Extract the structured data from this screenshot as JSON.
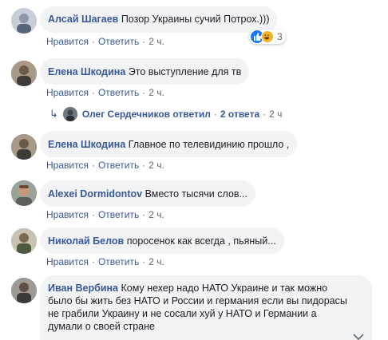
{
  "comments": [
    {
      "author": "Алсай Шагаев",
      "text": "Позор Украины сучий Потрох.)))",
      "like_label": "Нравится",
      "reply_label": "Ответить",
      "time": "2 ч.",
      "reactions": {
        "count": "3",
        "icons": [
          "like-icon",
          "haha-icon"
        ]
      }
    },
    {
      "author": "Елена Шкодина",
      "text": "Это выступление для тв",
      "like_label": "Нравится",
      "reply_label": "Ответить",
      "time": "2 ч.",
      "replies": {
        "text": "Олег Сердечников ответил",
        "count": "2 ответа",
        "time": "2 ч"
      }
    },
    {
      "author": "Елена Шкодина",
      "text": "Главное по телевидинию прошло ,",
      "like_label": "Нравится",
      "reply_label": "Ответить",
      "time": "2 ч."
    },
    {
      "author": "Alexei Dormidontov",
      "text": "Вместо тысячи слов...",
      "like_label": "Нравится",
      "reply_label": "Ответить",
      "time": "2 ч."
    },
    {
      "author": "Николай Белов",
      "text": "поросенок как всегда , пьяный...",
      "like_label": "Нравится",
      "reply_label": "Ответить",
      "time": "2 ч."
    },
    {
      "author": "Иван Вербина",
      "text_lines": [
        "Кому нехер надо НАТО Украине и так можно",
        "было бы жить без НАТО и России и германия если вы пидорасы",
        "не грабили Украину и не сосали хуй у НАТО и Германии а",
        "думали о своей стране"
      ]
    }
  ],
  "colors": {
    "link": "#385898",
    "bubble": "#f2f3f5",
    "meta": "#606770",
    "like": "#1877f2",
    "haha": "#f7b125"
  }
}
